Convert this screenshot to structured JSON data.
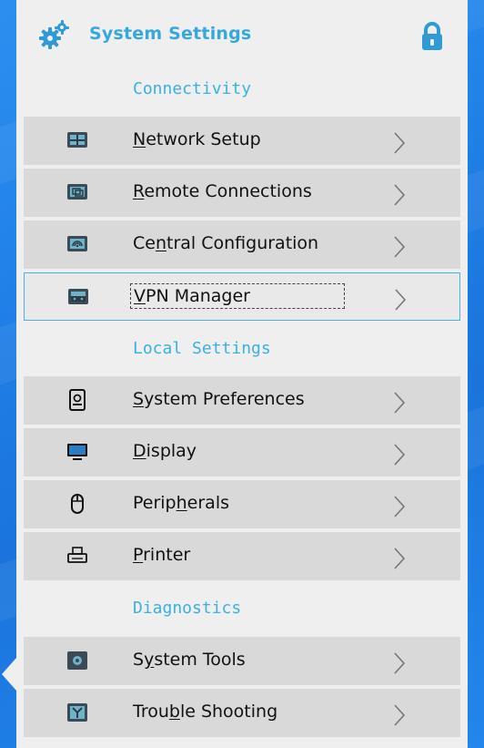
{
  "header": {
    "title": "System Settings",
    "icons": {
      "left": "gears-icon",
      "right": "lock-icon"
    }
  },
  "sections": [
    {
      "label": "Connectivity"
    },
    {
      "label": "Local Settings"
    },
    {
      "label": "Diagnostics"
    }
  ],
  "items": [
    {
      "label_pre": "",
      "label_u": "N",
      "label_post": "etwork Setup",
      "icon": "network-icon",
      "selected": false
    },
    {
      "label_pre": "",
      "label_u": "R",
      "label_post": "emote Connections",
      "icon": "remote-icon",
      "selected": false
    },
    {
      "label_pre": "Ce",
      "label_u": "n",
      "label_post": "tral Configuration",
      "icon": "central-config-icon",
      "selected": false
    },
    {
      "label_pre": "",
      "label_u": "V",
      "label_post": "PN Manager",
      "icon": "vpn-icon",
      "selected": true
    },
    {
      "label_pre": "",
      "label_u": "S",
      "label_post": "ystem Preferences",
      "icon": "preferences-icon",
      "selected": false
    },
    {
      "label_pre": "",
      "label_u": "D",
      "label_post": "isplay",
      "icon": "display-icon",
      "selected": false
    },
    {
      "label_pre": "Perip",
      "label_u": "h",
      "label_post": "erals",
      "icon": "mouse-icon",
      "selected": false
    },
    {
      "label_pre": "",
      "label_u": "P",
      "label_post": "rinter",
      "icon": "printer-icon",
      "selected": false
    },
    {
      "label_pre": "S",
      "label_u": "y",
      "label_post": "stem Tools",
      "icon": "tools-icon",
      "selected": false
    },
    {
      "label_pre": "Trou",
      "label_u": "b",
      "label_post": "le Shooting",
      "icon": "troubleshooting-icon",
      "selected": false
    }
  ],
  "colors": {
    "accent": "#35a8df",
    "row_bg": "#d9d9d9",
    "panel_bg": "#efefef",
    "selected_border": "#47b2e6"
  }
}
